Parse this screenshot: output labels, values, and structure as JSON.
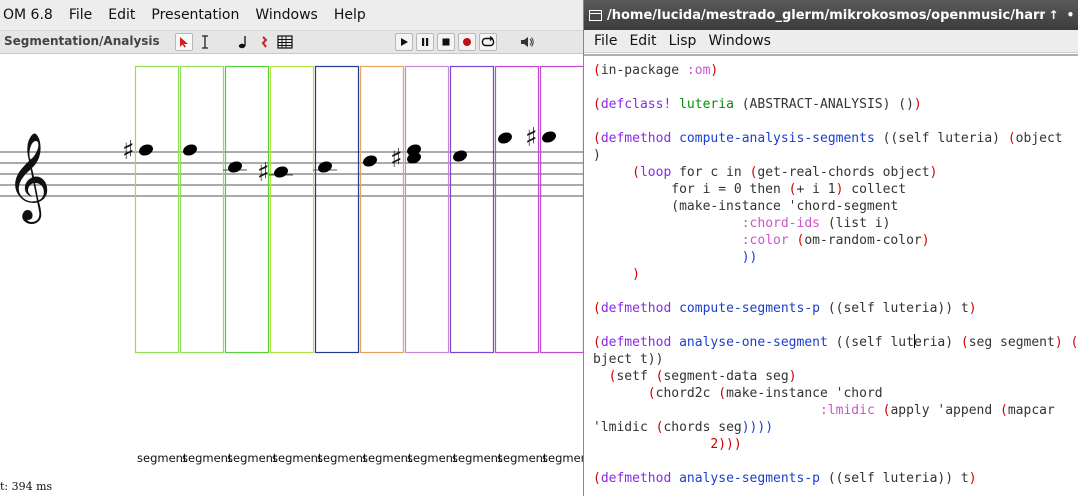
{
  "om": {
    "menu": [
      "OM 6.8",
      "File",
      "Edit",
      "Presentation",
      "Windows",
      "Help"
    ],
    "mode_label": "Segmentation/Analysis",
    "tool_icons": [
      "cursor-arrow-icon",
      "text-cursor-icon",
      "note-icon",
      "rest-icon",
      "grid-icon"
    ],
    "transport_icons": [
      "play-icon",
      "pause-icon",
      "stop-icon",
      "record-icon",
      "loop-icon",
      "speaker-icon"
    ],
    "segment_label": "segment",
    "segment_colors": [
      "#8ee05a",
      "#8ee05a",
      "#54d03a",
      "#b7e246",
      "#1f3a8f",
      "#e7a45a",
      "#c28ad6",
      "#7a45d0",
      "#c04ad0",
      "#c04ad0"
    ],
    "notes": [
      {
        "sharp": true
      },
      {
        "sharp": false
      },
      {
        "sharp": false
      },
      {
        "sharp": true
      },
      {
        "sharp": false
      },
      {
        "sharp": false
      },
      {
        "sharp": true
      },
      {
        "sharp": false
      },
      {
        "sharp": false
      },
      {
        "sharp": true
      }
    ],
    "status_time": "t: 394 ms"
  },
  "lisp": {
    "title": "/home/lucida/mestrado_glerm/mikrokosmos/openmusic/harmo",
    "title_controls": [
      "↑",
      "•"
    ],
    "menu": [
      "File",
      "Edit",
      "Lisp",
      "Windows"
    ],
    "code_lines": [
      [
        {
          "t": "(",
          "c": "c-paren"
        },
        {
          "t": "in-package ",
          "c": "c-op"
        },
        {
          "t": ":om",
          "c": "c-key"
        },
        {
          "t": ")",
          "c": "c-paren"
        }
      ],
      [],
      [
        {
          "t": "(",
          "c": "c-paren"
        },
        {
          "t": "defclass!",
          "c": "c-def"
        },
        {
          "t": " luteria ",
          "c": "c-cls"
        },
        {
          "t": "(ABSTRACT-ANALYSIS) ()",
          "c": "c-op"
        },
        {
          "t": ")",
          "c": "c-paren"
        }
      ],
      [],
      [
        {
          "t": "(",
          "c": "c-paren"
        },
        {
          "t": "defmethod",
          "c": "c-def"
        },
        {
          "t": " compute-analysis-segments ",
          "c": "c-fn"
        },
        {
          "t": "((self luteria) ",
          "c": "c-op"
        },
        {
          "t": "(",
          "c": "c-paren"
        },
        {
          "t": "object",
          "c": "c-op"
        }
      ],
      [
        {
          "t": ")",
          "c": "c-op"
        }
      ],
      [
        {
          "t": "     (",
          "c": "c-paren"
        },
        {
          "t": "loop",
          "c": "c-def"
        },
        {
          "t": " for c in ",
          "c": "c-op"
        },
        {
          "t": "(",
          "c": "c-paren"
        },
        {
          "t": "get-real-chords object",
          "c": "c-op"
        },
        {
          "t": ")",
          "c": "c-paren"
        }
      ],
      [
        {
          "t": "          for i = 0 then ",
          "c": "c-op"
        },
        {
          "t": "(",
          "c": "c-paren"
        },
        {
          "t": "+ i 1",
          "c": "c-op"
        },
        {
          "t": ")",
          "c": "c-paren"
        },
        {
          "t": " collect",
          "c": "c-op"
        }
      ],
      [
        {
          "t": "          (make-instance 'chord-segment",
          "c": "c-op"
        }
      ],
      [
        {
          "t": "                   ",
          "c": "c-op"
        },
        {
          "t": ":chord-ids",
          "c": "c-key"
        },
        {
          "t": " (list i)",
          "c": "c-op"
        }
      ],
      [
        {
          "t": "                   ",
          "c": "c-op"
        },
        {
          "t": ":color",
          "c": "c-key"
        },
        {
          "t": " ",
          "c": "c-op"
        },
        {
          "t": "(",
          "c": "c-paren"
        },
        {
          "t": "om-random-color",
          "c": "c-op"
        },
        {
          "t": ")",
          "c": "c-paren"
        }
      ],
      [
        {
          "t": "                   ))",
          "c": "c-fn"
        }
      ],
      [
        {
          "t": "     )",
          "c": "c-paren"
        }
      ],
      [],
      [
        {
          "t": "(",
          "c": "c-paren"
        },
        {
          "t": "defmethod",
          "c": "c-def"
        },
        {
          "t": " compute-segments-p ",
          "c": "c-fn"
        },
        {
          "t": "((self luteria)) t",
          "c": "c-op"
        },
        {
          "t": ")",
          "c": "c-paren"
        }
      ],
      [],
      [
        {
          "t": "(",
          "c": "c-paren"
        },
        {
          "t": "defmethod",
          "c": "c-def"
        },
        {
          "t": " analyse-one-segment ",
          "c": "c-fn"
        },
        {
          "t": "((self lut",
          "c": "c-op"
        },
        {
          "t": "|",
          "c": "cursor"
        },
        {
          "t": "eria) ",
          "c": "c-op"
        },
        {
          "t": "(",
          "c": "c-paren"
        },
        {
          "t": "seg segment",
          "c": "c-op"
        },
        {
          "t": ")",
          "c": "c-paren"
        },
        {
          "t": " ",
          "c": "c-op"
        },
        {
          "t": "(",
          "c": "c-paren"
        },
        {
          "t": "o",
          "c": "c-op"
        }
      ],
      [
        {
          "t": "bject t))",
          "c": "c-op"
        }
      ],
      [
        {
          "t": "  (",
          "c": "c-paren"
        },
        {
          "t": "setf ",
          "c": "c-op"
        },
        {
          "t": "(",
          "c": "c-paren"
        },
        {
          "t": "segment-data seg",
          "c": "c-op"
        },
        {
          "t": ")",
          "c": "c-paren"
        }
      ],
      [
        {
          "t": "       (",
          "c": "c-paren"
        },
        {
          "t": "chord2c ",
          "c": "c-op"
        },
        {
          "t": "(",
          "c": "c-paren"
        },
        {
          "t": "make-instance 'chord",
          "c": "c-op"
        }
      ],
      [
        {
          "t": "                             ",
          "c": "c-op"
        },
        {
          "t": ":lmidic",
          "c": "c-key"
        },
        {
          "t": " ",
          "c": "c-op"
        },
        {
          "t": "(",
          "c": "c-paren"
        },
        {
          "t": "apply 'append ",
          "c": "c-op"
        },
        {
          "t": "(",
          "c": "c-paren"
        },
        {
          "t": "mapcar",
          "c": "c-op"
        }
      ],
      [
        {
          "t": "'lmidic ",
          "c": "c-op"
        },
        {
          "t": "(",
          "c": "c-paren"
        },
        {
          "t": "chords seg",
          "c": "c-op"
        },
        {
          "t": "))))",
          "c": "c-fn"
        }
      ],
      [
        {
          "t": "               2)))",
          "c": "c-paren"
        }
      ],
      [],
      [
        {
          "t": "(",
          "c": "c-paren"
        },
        {
          "t": "defmethod",
          "c": "c-def"
        },
        {
          "t": " analyse-segments-p ",
          "c": "c-fn"
        },
        {
          "t": "((self luteria)) t",
          "c": "c-op"
        },
        {
          "t": ")",
          "c": "c-paren"
        }
      ]
    ]
  }
}
